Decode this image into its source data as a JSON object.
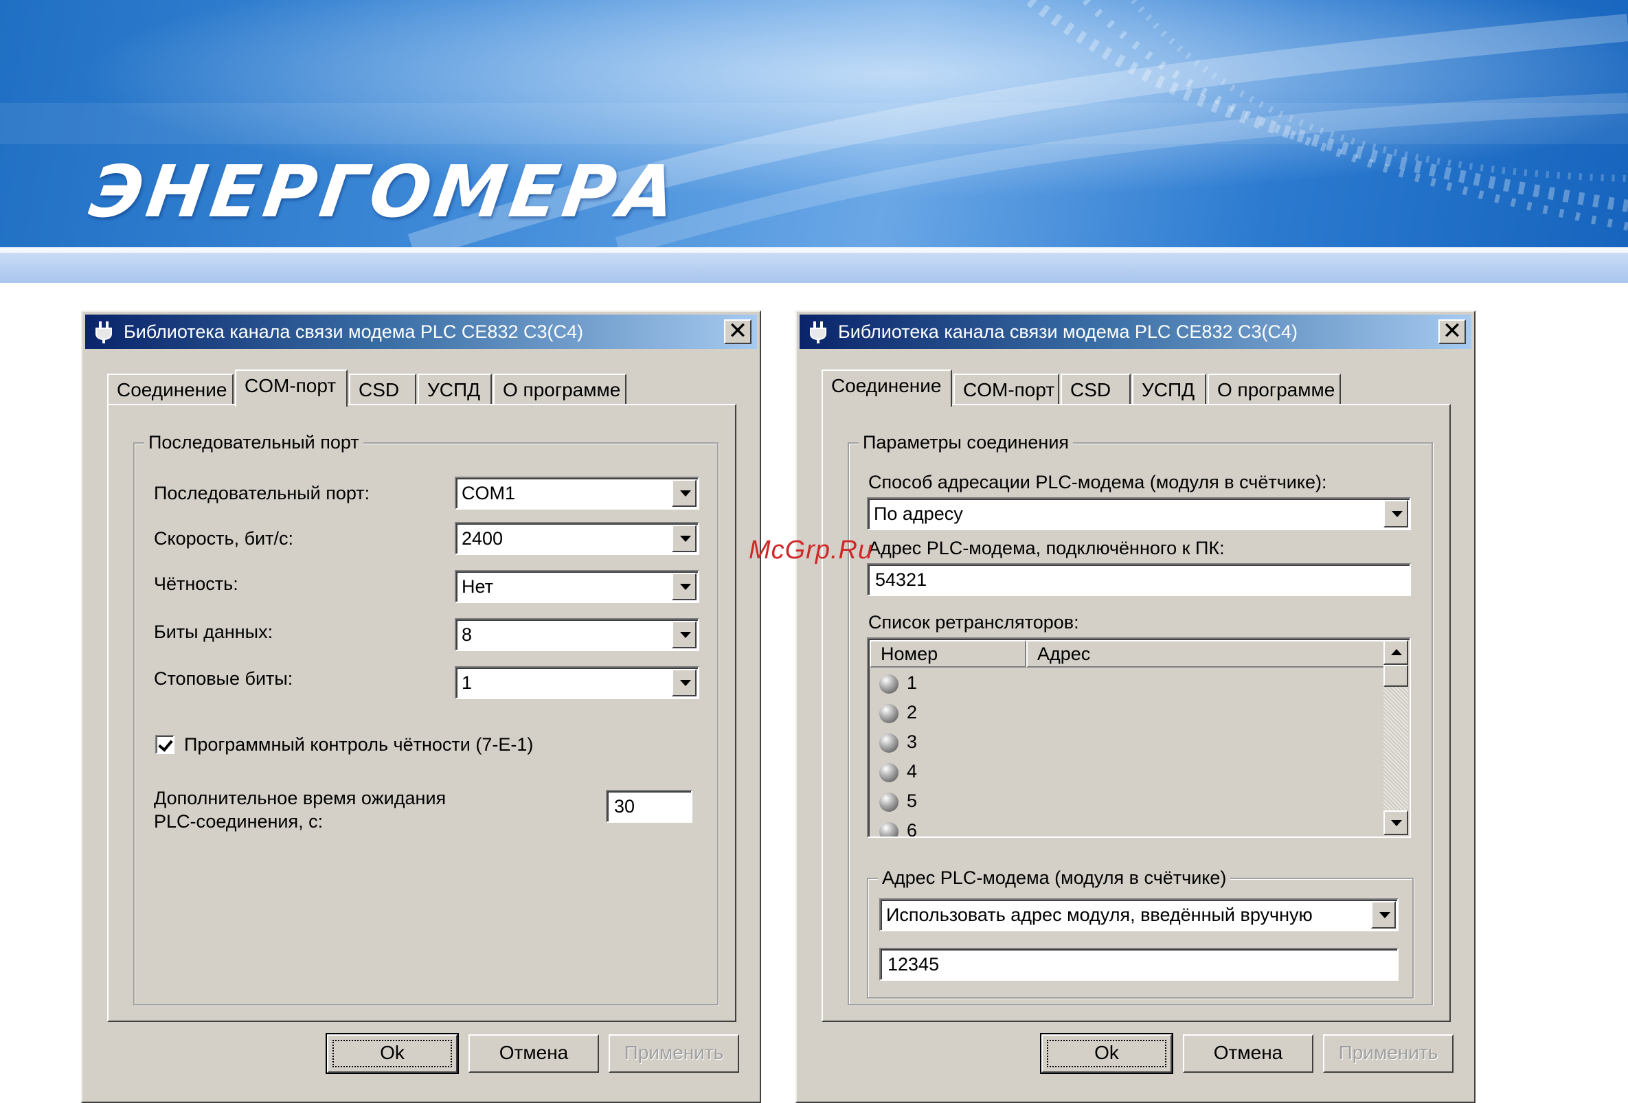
{
  "header": {
    "logo_text": "ЭНЕРГОМЕРА"
  },
  "watermark": "McGrp.Ru",
  "left_dialog": {
    "title": "Библиотека канала связи модема PLC CE832 C3(C4)",
    "tabs": [
      {
        "label": "Соединение",
        "active": false
      },
      {
        "label": "COM-порт",
        "active": true
      },
      {
        "label": "CSD",
        "active": false
      },
      {
        "label": "УСПД",
        "active": false
      },
      {
        "label": "О программе",
        "active": false
      }
    ],
    "group_title": "Последовательный порт",
    "fields": [
      {
        "label": "Последовательный порт:",
        "value": "COM1"
      },
      {
        "label": "Скорость, бит/с:",
        "value": "2400"
      },
      {
        "label": "Чётность:",
        "value": "Нет"
      },
      {
        "label": "Биты данных:",
        "value": "8"
      },
      {
        "label": "Стоповые биты:",
        "value": "1"
      }
    ],
    "parity_check": {
      "label": "Программный контроль чётности (7-E-1)",
      "checked": true
    },
    "timeout": {
      "label_line1": "Дополнительное время ожидания",
      "label_line2": "PLC-соединения, с:",
      "value": "30"
    },
    "buttons": {
      "ok": "Ok",
      "cancel": "Отмена",
      "apply": "Применить"
    }
  },
  "right_dialog": {
    "title": "Библиотека канала связи модема PLC CE832 C3(C4)",
    "tabs": [
      {
        "label": "Соединение",
        "active": true
      },
      {
        "label": "COM-порт",
        "active": false
      },
      {
        "label": "CSD",
        "active": false
      },
      {
        "label": "УСПД",
        "active": false
      },
      {
        "label": "О программе",
        "active": false
      }
    ],
    "group_title": "Параметры соединения",
    "addressing": {
      "label": "Способ адресации PLC-модема (модуля в счётчике):",
      "value": "По адресу"
    },
    "pc_modem_address": {
      "label": "Адрес PLC-модема, подключённого к ПК:",
      "value": "54321"
    },
    "repeaters": {
      "label": "Список ретрансляторов:",
      "columns": [
        "Номер",
        "Адрес"
      ],
      "rows": [
        "1",
        "2",
        "3",
        "4",
        "5",
        "6"
      ]
    },
    "module_group": {
      "title": "Адрес PLC-модема (модуля в счётчике)",
      "mode": "Использовать адрес модуля, введённый вручную",
      "address": "12345"
    },
    "buttons": {
      "ok": "Ok",
      "cancel": "Отмена",
      "apply": "Применить"
    }
  }
}
